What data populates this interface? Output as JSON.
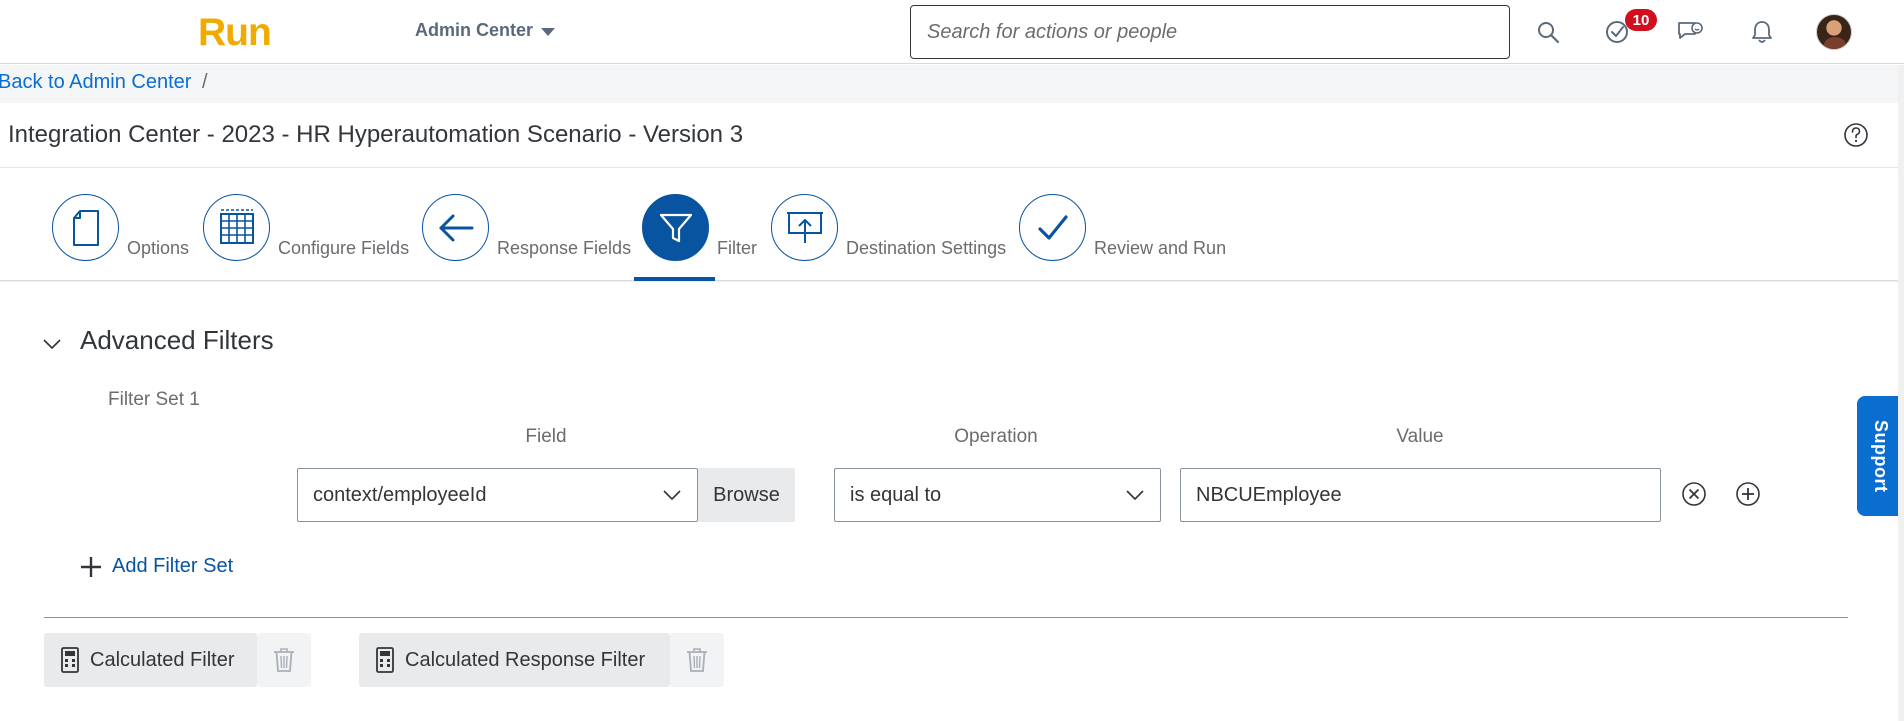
{
  "shell": {
    "logo": "Run",
    "product_menu": "Admin Center",
    "search_placeholder": "Search for actions or people",
    "notifications_badge": "10",
    "icons": [
      "search-icon",
      "task-check-icon",
      "chat-feedback-icon",
      "bell-icon"
    ]
  },
  "breadcrumb": {
    "link": "Back to Admin Center",
    "separator": "/"
  },
  "page": {
    "title": "Integration Center - 2023 - HR Hyperautomation Scenario - Version 3"
  },
  "wizard": {
    "active_step": "Filter",
    "steps": [
      {
        "label": "Options",
        "icon": "document-icon"
      },
      {
        "label": "Configure Fields",
        "icon": "table-grid-icon"
      },
      {
        "label": "Response Fields",
        "icon": "arrow-left-icon"
      },
      {
        "label": "Filter",
        "icon": "funnel-icon"
      },
      {
        "label": "Destination Settings",
        "icon": "upload-screen-icon"
      },
      {
        "label": "Review and Run",
        "icon": "checkmark-icon"
      }
    ]
  },
  "filters": {
    "section_title": "Advanced Filters",
    "set_label": "Filter Set 1",
    "columns": {
      "field": "Field",
      "operation": "Operation",
      "value": "Value"
    },
    "row": {
      "field": "context/employeeId",
      "browse": "Browse",
      "operation": "is equal to",
      "value": "NBCUEmployee"
    },
    "add_filter_set": "Add Filter Set"
  },
  "calculated": {
    "filter": "Calculated Filter",
    "response_filter": "Calculated Response Filter"
  },
  "support_tab": "Support",
  "colors": {
    "brand_gold": "#f0ab00",
    "primary_blue": "#0854a0",
    "link_blue": "#0a6ed1",
    "badge_red": "#d0101f"
  }
}
